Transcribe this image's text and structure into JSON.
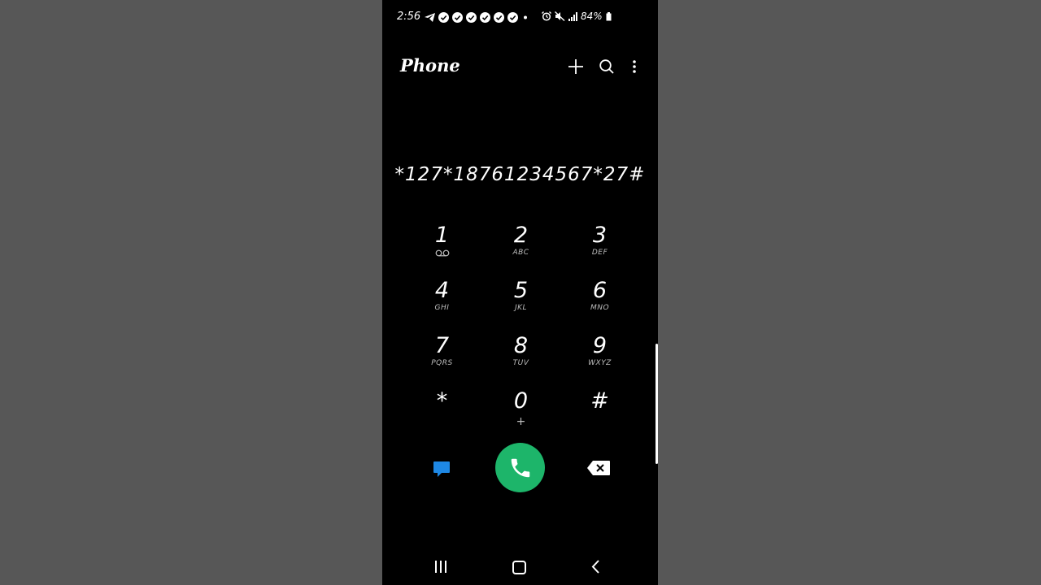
{
  "status_bar": {
    "time": "2:56",
    "battery": "84%",
    "notification_icons": [
      "telegram-icon",
      "check-circle-icon",
      "check-circle-icon",
      "check-circle-icon",
      "check-circle-icon",
      "check-circle-icon",
      "check-circle-icon",
      "dot-icon"
    ],
    "system_icons": [
      "alarm-icon",
      "mute-icon",
      "signal-icon",
      "battery-icon"
    ]
  },
  "header": {
    "title": "Phone",
    "actions": [
      "add-icon",
      "search-icon",
      "more-vert-icon"
    ]
  },
  "dial_display": {
    "value": "*127*18761234567*27#"
  },
  "keypad": {
    "keys": [
      {
        "digit": "1",
        "letters": "",
        "sub_icon": "voicemail-icon"
      },
      {
        "digit": "2",
        "letters": "ABC"
      },
      {
        "digit": "3",
        "letters": "DEF"
      },
      {
        "digit": "4",
        "letters": "GHI"
      },
      {
        "digit": "5",
        "letters": "JKL"
      },
      {
        "digit": "6",
        "letters": "MNO"
      },
      {
        "digit": "7",
        "letters": "PQRS"
      },
      {
        "digit": "8",
        "letters": "TUV"
      },
      {
        "digit": "9",
        "letters": "WXYZ"
      },
      {
        "digit": "*",
        "letters": ""
      },
      {
        "digit": "0",
        "letters": "+"
      },
      {
        "digit": "#",
        "letters": ""
      }
    ]
  },
  "actions": {
    "message_icon": "message-icon",
    "call_icon": "phone-icon",
    "backspace_icon": "backspace-icon"
  },
  "colors": {
    "background": "#000000",
    "call_button": "#1db56a",
    "message_icon": "#1e88e5",
    "outer_background": "#575757"
  },
  "nav_bar": {
    "icons": [
      "recents-icon",
      "home-icon",
      "back-icon"
    ]
  }
}
